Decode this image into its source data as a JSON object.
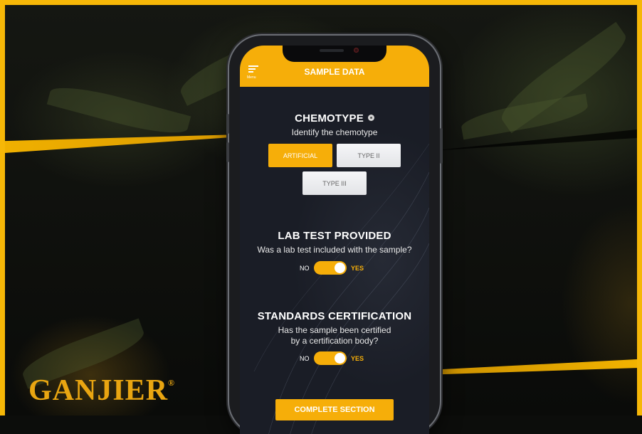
{
  "brand": {
    "logo_text": "GANJIER",
    "registered_mark": "®"
  },
  "colors": {
    "accent": "#f6ae09",
    "frame": "#f6b707",
    "screen_bg": "#1a1d26"
  },
  "app": {
    "header": {
      "title": "SAMPLE DATA",
      "menu_label": "Menu",
      "menu_icon": "hamburger-icon"
    },
    "chemotype": {
      "title": "CHEMOTYPE",
      "subtitle": "Identify the chemotype",
      "info_icon": "info-icon",
      "options": [
        {
          "label": "ARTIFICIAL",
          "selected": true
        },
        {
          "label": "TYPE II",
          "selected": false
        },
        {
          "label": "TYPE III",
          "selected": false
        }
      ]
    },
    "lab_test": {
      "title": "LAB TEST PROVIDED",
      "question": "Was a lab test included with the sample?",
      "no_label": "NO",
      "yes_label": "YES",
      "value": "YES"
    },
    "certification": {
      "title": "STANDARDS CERTIFICATION",
      "question_line1": "Has the sample been certified",
      "question_line2": "by a certification body?",
      "no_label": "NO",
      "yes_label": "YES",
      "value": "YES"
    },
    "complete_button": "COMPLETE SECTION"
  }
}
